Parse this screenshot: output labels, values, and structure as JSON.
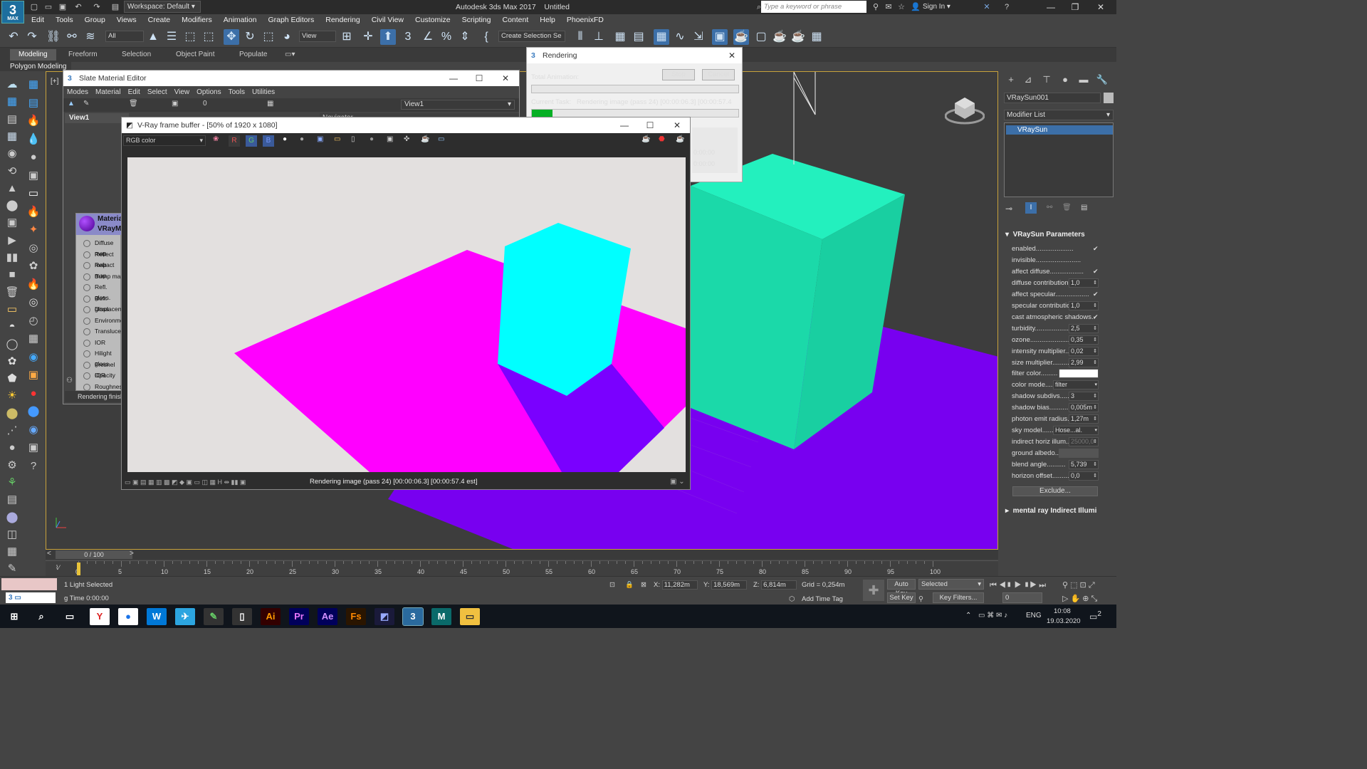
{
  "app": {
    "title": "Autodesk 3ds Max 2017",
    "doc": "Untitled",
    "logo": "3",
    "logo_sub": "MAX",
    "workspace": "Workspace: Default",
    "search_placeholder": "Type a keyword or phrase",
    "signin": "Sign In"
  },
  "menu": [
    "Edit",
    "Tools",
    "Group",
    "Views",
    "Create",
    "Modifiers",
    "Animation",
    "Graph Editors",
    "Rendering",
    "Civil View",
    "Customize",
    "Scripting",
    "Content",
    "Help",
    "PhoenixFD"
  ],
  "toolbar": {
    "selection_filter": "All",
    "ref_coord": "View",
    "named_selection": "Create Selection Se"
  },
  "ribbon": {
    "tabs": [
      "Modeling",
      "Freeform",
      "Selection",
      "Object Paint",
      "Populate"
    ],
    "active": "Modeling",
    "subtitle": "Polygon Modeling"
  },
  "slate": {
    "title": "Slate Material Editor",
    "menu": [
      "Modes",
      "Material",
      "Edit",
      "Select",
      "View",
      "Options",
      "Tools",
      "Utilities"
    ],
    "view_dropdown": "View1",
    "view_tab": "View1",
    "navigator": "Navigator",
    "node_title": "Materia",
    "node_sub": "VRayM",
    "slots": [
      "Diffuse map",
      "Reflect map",
      "Refract map",
      "Bump map",
      "Refl. gloss.",
      "Refr. gloss.",
      "Displacement",
      "Environment",
      "Translucency",
      "IOR",
      "Hilight gloss",
      "Fresnel IOR",
      "Opacity",
      "Roughness"
    ],
    "status": "Rendering finish"
  },
  "rendering": {
    "title": "Rendering",
    "total_label": "Total Animation:",
    "stop": "Stop",
    "cancel": "Cancel",
    "task_label": "Current Task:",
    "task_value": "Rendering image (pass 24) [00:00:06.3] [00:00:57.4",
    "progress": 0.1,
    "time1": "0:00:00",
    "time2": "0:00:00"
  },
  "vfb": {
    "title": "V-Ray frame buffer - [50% of 1920 x 1080]",
    "channel": "RGB color",
    "status": "Rendering image (pass 24) [00:00:06.3] [00:00:57.4 est]"
  },
  "viewport": {
    "label": "[+]"
  },
  "command_panel": {
    "object_name": "VRaySun001",
    "modifier_list": "Modifier List",
    "stack_item": "VRaySun",
    "rollout_title": "VRaySun Parameters",
    "params": [
      {
        "label": "enabled....................",
        "value": "✔",
        "type": "check"
      },
      {
        "label": "invisible........................",
        "value": "",
        "type": "check"
      },
      {
        "label": "affect diffuse..................",
        "value": "✔",
        "type": "check"
      },
      {
        "label": "diffuse contribution",
        "value": "1,0",
        "type": "spin"
      },
      {
        "label": "affect specular..................",
        "value": "✔",
        "type": "check"
      },
      {
        "label": "specular contributio",
        "value": "1,0",
        "type": "spin"
      },
      {
        "label": "cast atmospheric shadows..",
        "value": "✔",
        "type": "check"
      },
      {
        "label": "turbidity..................",
        "value": "2,5",
        "type": "spin"
      },
      {
        "label": "ozone......................",
        "value": "0,35",
        "type": "spin"
      },
      {
        "label": "intensity multiplier..",
        "value": "0,02",
        "type": "spin"
      },
      {
        "label": "size multiplier..........",
        "value": "2,99",
        "type": "spin"
      },
      {
        "label": "filter color.........",
        "value": "",
        "type": "color"
      },
      {
        "label": "color mode....",
        "value": "filter",
        "type": "drop"
      },
      {
        "label": "shadow subdivs........",
        "value": "3",
        "type": "spin"
      },
      {
        "label": "shadow bias............",
        "value": "0,005m",
        "type": "spin"
      },
      {
        "label": "photon emit radius.",
        "value": "1,27m",
        "type": "spin"
      },
      {
        "label": "sky model........",
        "value": "Hose...al.",
        "type": "drop"
      },
      {
        "label": "indirect horiz illum...",
        "value": "25000,0",
        "type": "spin"
      },
      {
        "label": "ground albedo..",
        "value": "",
        "type": "color"
      },
      {
        "label": "blend angle..........",
        "value": "5,739",
        "type": "spin"
      },
      {
        "label": "horizon offset.........",
        "value": "0,0",
        "type": "spin"
      }
    ],
    "exclude": "Exclude...",
    "mr_rollout": "mental ray Indirect Illumi"
  },
  "timeline": {
    "frame": "0 / 100",
    "ticks": [
      "0",
      "5",
      "10",
      "15",
      "20",
      "25",
      "30",
      "35",
      "40",
      "45",
      "50",
      "55",
      "60",
      "65",
      "70",
      "75",
      "80",
      "85",
      "90",
      "95",
      "100"
    ]
  },
  "status": {
    "selection": "1 Light Selected",
    "render_time": "g Time  0:00:00",
    "x_label": "X:",
    "x": "11,282m",
    "y_label": "Y:",
    "y": "18,569m",
    "z_label": "Z:",
    "z": "6,814m",
    "grid": "Grid = 0,254m",
    "add_time_tag": "Add Time Tag",
    "auto_key": "Auto Key",
    "selected": "Selected",
    "set_key": "Set Key",
    "key_filters": "Key Filters...",
    "frame_field": "0"
  },
  "taskbar": {
    "lang": "ENG",
    "time": "10:08",
    "date": "19.03.2020",
    "notif": "2",
    "apps": [
      "Y",
      "●",
      "W",
      "✈",
      "✎",
      "▯",
      "Ai",
      "Pr",
      "Ae",
      "Fs",
      "◩",
      "3",
      "M",
      "▭"
    ]
  },
  "colors": {
    "magenta": "#ff00ff",
    "cyan": "#00ffff",
    "teal": "#1ee3b0",
    "purple": "#7a00f0",
    "accent": "#3c6fa8"
  }
}
